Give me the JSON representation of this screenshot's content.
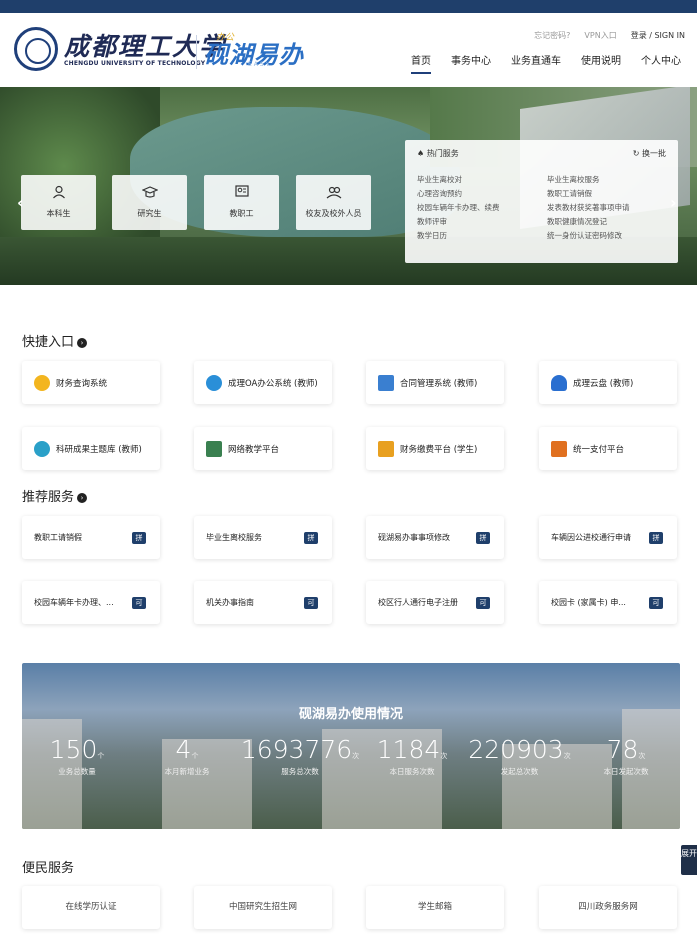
{
  "header": {
    "university_cn": "成都理工大学",
    "university_en": "CHENGDU UNIVERSITY OF TECHNOLOGY",
    "brand": "砚湖易办",
    "brand_sub": "办公",
    "brand_small": "EASY",
    "links": {
      "forgot": "忘记密码?",
      "vpn": "VPN入口",
      "login": "登录 / SIGN IN"
    },
    "nav": [
      "首页",
      "事务中心",
      "业务直通车",
      "使用说明",
      "个人中心"
    ]
  },
  "hero": {
    "arrow_left": "‹",
    "arrow_right": "›",
    "roles": [
      {
        "label": "本科生",
        "icon": "person-icon"
      },
      {
        "label": "研究生",
        "icon": "graduation-cap-icon"
      },
      {
        "label": "教职工",
        "icon": "staff-icon"
      },
      {
        "label": "校友及校外人员",
        "icon": "group-icon"
      }
    ],
    "panel": {
      "title": "热门服务",
      "refresh": "换一批",
      "items": [
        "毕业生离校对",
        "毕业生离校服务",
        "心理咨询预约",
        "教职工请销假",
        "校园车辆年卡办理、续费",
        "发表教材获奖著事项申请",
        "教师评审",
        "教职健康情况登记",
        "教学日历",
        "统一身份认证密码修改"
      ]
    }
  },
  "quick_entry": {
    "title": "快捷入口",
    "items": [
      {
        "label": "财务查询系统",
        "color": "#f3b51f"
      },
      {
        "label": "成理OA办公系统 (教师)",
        "color": "#2a8fd8"
      },
      {
        "label": "合同管理系统 (教师)",
        "color": "#3a7fd0"
      },
      {
        "label": "成理云盘 (教师)",
        "color": "#2a6fd0"
      },
      {
        "label": "科研成果主题库 (教师)",
        "color": "#2aa0c8"
      },
      {
        "label": "网络教学平台",
        "color": "#3a8050"
      },
      {
        "label": "财务缴费平台 (学生)",
        "color": "#e8a020"
      },
      {
        "label": "统一支付平台",
        "color": "#e07020"
      }
    ]
  },
  "recommended": {
    "title": "推荐服务",
    "items": [
      {
        "label": "教职工请销假",
        "tag": "拼"
      },
      {
        "label": "毕业生离校服务",
        "tag": "拼"
      },
      {
        "label": "砚湖易办事事项修改",
        "tag": "拼"
      },
      {
        "label": "车辆因公进校通行申请",
        "tag": "拼"
      },
      {
        "label": "校园车辆年卡办理、...",
        "tag": "可"
      },
      {
        "label": "机关办事指南",
        "tag": "可"
      },
      {
        "label": "校区行人通行电子注册",
        "tag": "可"
      },
      {
        "label": "校园卡 (家属卡) 申...",
        "tag": "可"
      }
    ]
  },
  "stats": {
    "title": "砚湖易办使用情况",
    "items": [
      {
        "num": "150",
        "unit": "个",
        "label": "业务总数量"
      },
      {
        "num": "4",
        "unit": "个",
        "label": "本月新增业务"
      },
      {
        "num": "1693776",
        "unit": "次",
        "label": "服务总次数"
      },
      {
        "num": "1184",
        "unit": "次",
        "label": "本日服务次数"
      },
      {
        "num": "220903",
        "unit": "次",
        "label": "发起总次数"
      },
      {
        "num": "78",
        "unit": "次",
        "label": "本日发起次数"
      }
    ]
  },
  "side_tab": "展开",
  "convenience": {
    "title": "便民服务",
    "items": [
      "在线学历认证",
      "中国研究生招生网",
      "学生邮箱",
      "四川政务服务网"
    ]
  }
}
